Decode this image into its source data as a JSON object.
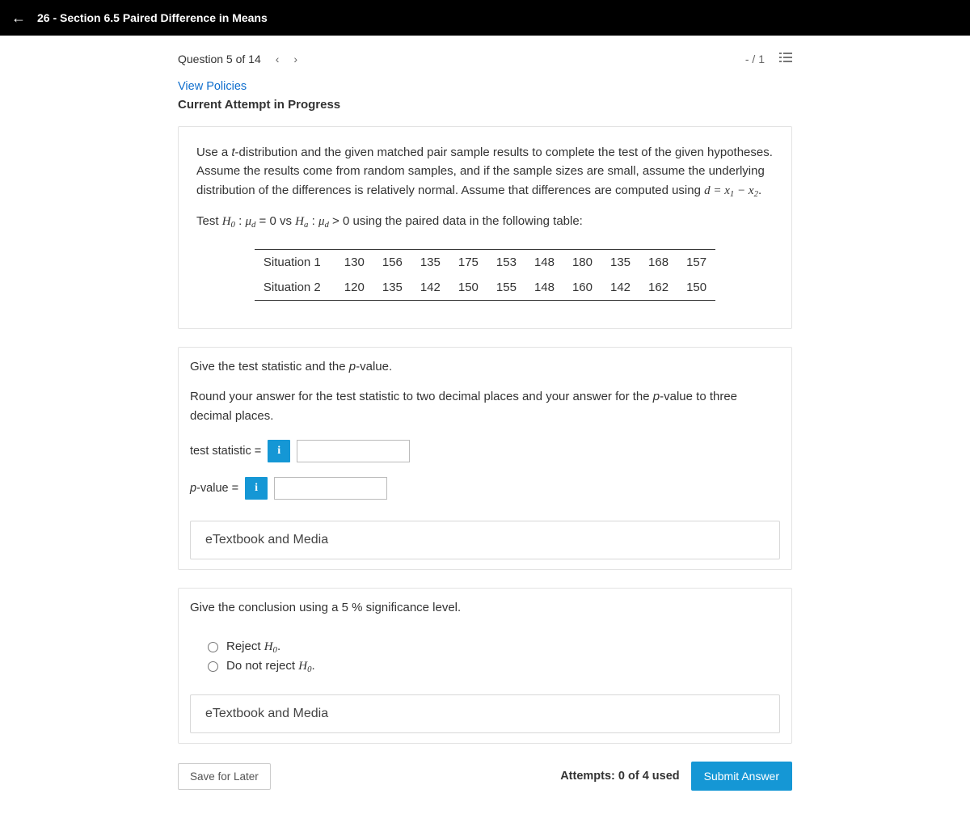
{
  "topbar": {
    "title": "26 - Section 6.5 Paired Difference in Means"
  },
  "nav": {
    "question_label": "Question 5 of 14",
    "score": "- / 1"
  },
  "header": {
    "view_policies": "View Policies",
    "attempt": "Current Attempt in Progress"
  },
  "prompt": {
    "p1_a": "Use a ",
    "p1_b": "t",
    "p1_c": "-distribution and the given matched pair sample results to complete the test of the given hypotheses. Assume the results come from random samples, and if the sample sizes are small, assume the underlying distribution of the differences is relatively normal. Assume that differences are computed using ",
    "p1_d": "d = x",
    "p1_e": " − x",
    "p1_f": ".",
    "p2_a": "Test ",
    "p2_b": " = 0 vs ",
    "p2_c": " > 0 using the paired data in the following table:"
  },
  "table": {
    "row1_label": "Situation 1",
    "row1": [
      "130",
      "156",
      "135",
      "175",
      "153",
      "148",
      "180",
      "135",
      "168",
      "157"
    ],
    "row2_label": "Situation 2",
    "row2": [
      "120",
      "135",
      "142",
      "150",
      "155",
      "148",
      "160",
      "142",
      "162",
      "150"
    ]
  },
  "section2": {
    "line1_a": "Give the test statistic and the ",
    "line1_b": "p",
    "line1_c": "-value.",
    "line2_a": "Round your answer for the test statistic to two decimal places and your answer for the ",
    "line2_b": "p",
    "line2_c": "-value to three decimal places.",
    "ts_label": "test statistic = ",
    "pv_label_a": "p",
    "pv_label_b": "-value = ",
    "etextbook": "eTextbook and Media"
  },
  "section3": {
    "line_a": "Give the conclusion using a 5 % ",
    "line_c": " significance level.",
    "opt1": "Reject ",
    "opt2": "Do not reject ",
    "h0_sub": "0",
    "period": ".",
    "etextbook": "eTextbook and Media"
  },
  "footer": {
    "save": "Save for Later",
    "attempts": "Attempts: 0 of 4 used",
    "submit": "Submit Answer"
  }
}
